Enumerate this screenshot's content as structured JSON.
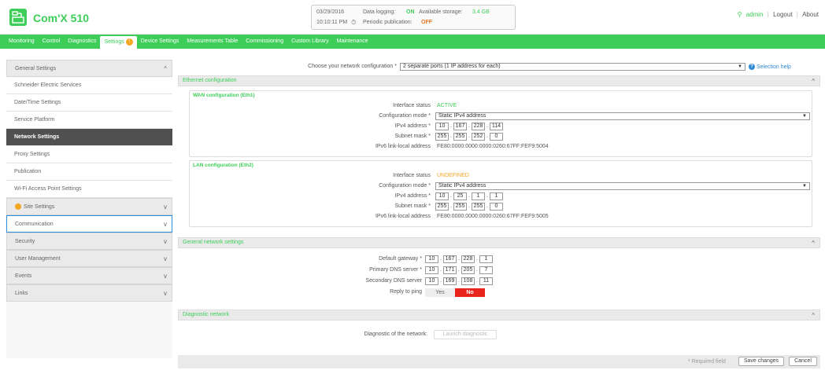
{
  "header": {
    "product": "Com'X 510",
    "status": {
      "date": "03/29/2016",
      "time": "10:10:11 PM",
      "data_logging_label": "Data logging:",
      "data_logging_value": "ON",
      "storage_label": "Available storage:",
      "storage_value": "3.4 GB",
      "publication_label": "Periodic publication:",
      "publication_value": "OFF"
    },
    "links": {
      "user": "admin",
      "logout": "Logout",
      "about": "About"
    }
  },
  "nav": {
    "items": [
      "Monitoring",
      "Control",
      "Diagnostics",
      "Settings",
      "Device Settings",
      "Measurements Table",
      "Commissioning",
      "Custom Library",
      "Maintenance"
    ],
    "settings_badge": "!"
  },
  "sidebar": {
    "general": "General Settings",
    "items": [
      "Schneider Electric Services",
      "Date/Time Settings",
      "Service Platform",
      "Network Settings",
      "Proxy Settings",
      "Publication",
      "Wi-Fi Access Point Settings"
    ],
    "groups": [
      "Site Settings",
      "Communication",
      "Security",
      "User Management",
      "Events",
      "Links"
    ]
  },
  "main": {
    "network_config_label": "Choose your network configuration",
    "network_config_value": "2 separate ports (1 IP address for each)",
    "selection_help": "Selection help",
    "ethernet_title": "Ethernet configuration",
    "wan": {
      "title": "WAN configuration (Eth1)",
      "status_label": "Interface status",
      "status_value": "ACTIVE",
      "mode_label": "Configuration mode",
      "mode_value": "Static IPv4 address",
      "ip_label": "IPv4 address",
      "ip": [
        "10",
        "167",
        "228",
        "114"
      ],
      "mask_label": "Subnet mask",
      "mask": [
        "255",
        "255",
        "252",
        "0"
      ],
      "ipv6_label": "IPv6 link-local address",
      "ipv6_value": "FE80:0000:0000:0000:0260:67FF:FEF9:5004"
    },
    "lan": {
      "title": "LAN configuration (Eth2)",
      "status_label": "Interface status",
      "status_value": "UNDEFINED",
      "mode_label": "Configuration mode",
      "mode_value": "Static IPv4 address",
      "ip_label": "IPv4 address",
      "ip": [
        "10",
        "25",
        "1",
        "1"
      ],
      "mask_label": "Subnet mask",
      "mask": [
        "255",
        "255",
        "255",
        "0"
      ],
      "ipv6_label": "IPv6 link-local address",
      "ipv6_value": "FE80:0000:0000:0000:0260:67FF:FEF9:5005"
    },
    "general_net_title": "General network settings",
    "gateway_label": "Default gateway",
    "gateway": [
      "10",
      "167",
      "228",
      "1"
    ],
    "dns1_label": "Primary DNS server",
    "dns1": [
      "10",
      "171",
      "205",
      "7"
    ],
    "dns2_label": "Secondary DNS server",
    "dns2": [
      "10",
      "169",
      "108",
      "11"
    ],
    "ping_label": "Reply to ping",
    "ping_yes": "Yes",
    "ping_no": "No",
    "diag_title": "Diagnostic network",
    "diag_label": "Diagnostic of the network",
    "diag_button": "Launch diagnostic",
    "required_mark": "*",
    "colon": ":",
    "ip_sep": "."
  },
  "footer": {
    "required": "Required field",
    "save": "Save changes",
    "cancel": "Cancel"
  },
  "colors": {
    "brand": "#3dcd58",
    "warning": "#f5a623",
    "danger": "#e8241c",
    "link": "#2e8bd9"
  }
}
